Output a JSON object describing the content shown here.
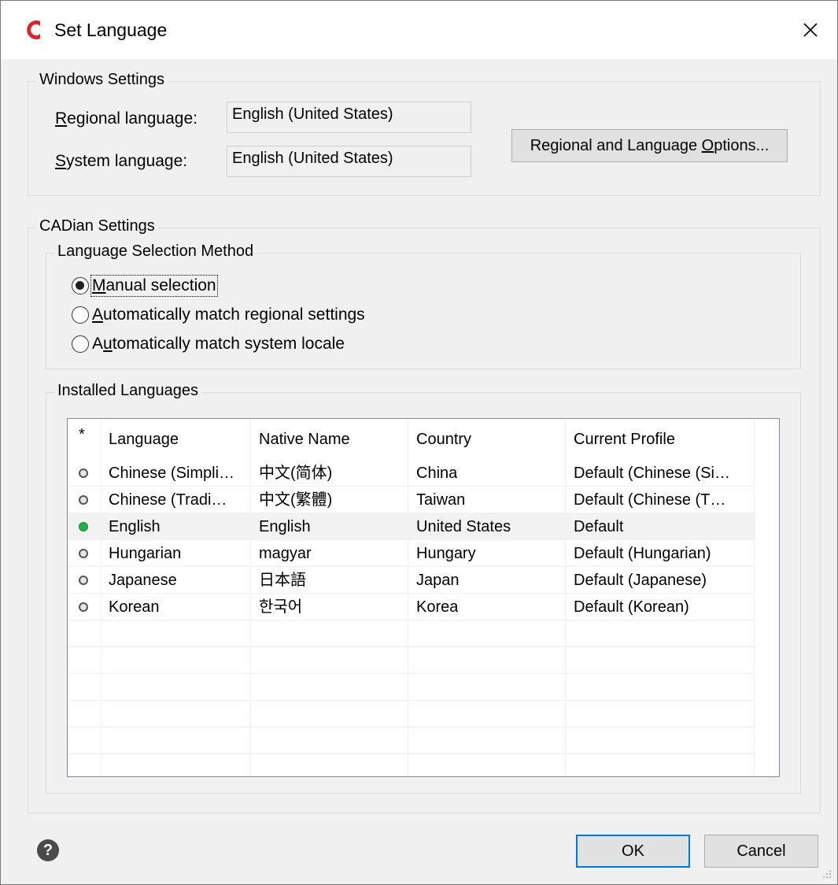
{
  "window": {
    "title": "Set Language"
  },
  "windows_settings": {
    "group_title": "Windows Settings",
    "regional_language_label_prefix": "",
    "regional_language_label_hotkey": "R",
    "regional_language_label_rest": "egional language:",
    "regional_language_value": "English (United States)",
    "system_language_label_hotkey": "S",
    "system_language_label_rest": "ystem language:",
    "system_language_value": "English (United States)",
    "options_button_pre": "Regional and Language ",
    "options_button_hotkey": "O",
    "options_button_post": "ptions..."
  },
  "cadian_settings": {
    "group_title": "CADian Settings",
    "method_group_title": "Language Selection Method",
    "methods": [
      {
        "hotkey": "M",
        "rest": "anual selection",
        "selected": true
      },
      {
        "hotkey": "A",
        "rest": "utomatically match regional settings",
        "selected": false
      },
      {
        "pre": "A",
        "hotkey": "u",
        "rest": "tomatically match system locale",
        "selected": false
      }
    ],
    "installed_group_title": "Installed Languages",
    "columns": [
      "*",
      "Language",
      "Native Name",
      "Country",
      "Current Profile"
    ],
    "rows": [
      {
        "status": "inactive",
        "language": "Chinese (Simpli…",
        "native": "中文(简体)",
        "country": "China",
        "profile": "Default (Chinese (Si…"
      },
      {
        "status": "inactive",
        "language": "Chinese (Tradi…",
        "native": "中文(繁體)",
        "country": "Taiwan",
        "profile": "Default (Chinese (T…"
      },
      {
        "status": "active",
        "language": "English",
        "native": "English",
        "country": "United States",
        "profile": "Default"
      },
      {
        "status": "inactive",
        "language": "Hungarian",
        "native": "magyar",
        "country": "Hungary",
        "profile": "Default (Hungarian)"
      },
      {
        "status": "inactive",
        "language": "Japanese",
        "native": "日本語",
        "country": "Japan",
        "profile": "Default (Japanese)"
      },
      {
        "status": "inactive",
        "language": "Korean",
        "native": "한국어",
        "country": "Korea",
        "profile": "Default (Korean)"
      }
    ]
  },
  "buttons": {
    "ok": "OK",
    "cancel": "Cancel"
  },
  "colors": {
    "active_dot": "#22b14c",
    "inactive_dot": "#9a9a9a",
    "accent": "#0078d7",
    "app_logo": "#d9262e"
  }
}
